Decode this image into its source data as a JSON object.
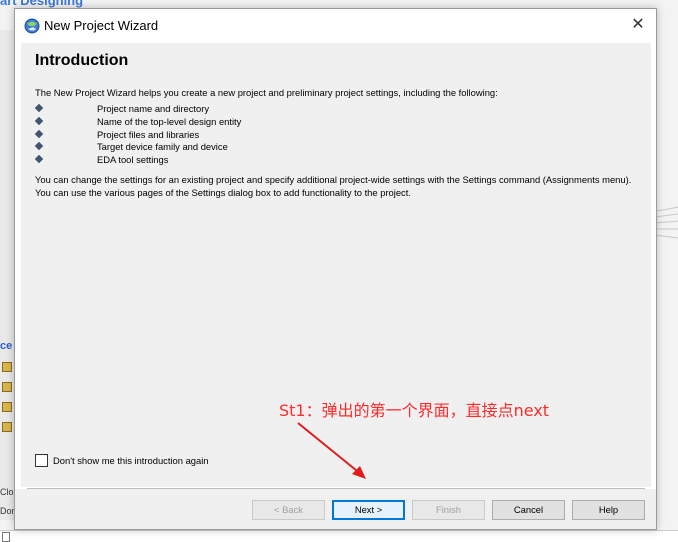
{
  "background": {
    "title_fragment": "art Designing",
    "left_fragment_1": "ce",
    "left_fragment_2": "Clos",
    "left_fragment_3": "Don"
  },
  "dialog": {
    "title": "New Project Wizard",
    "close_glyph": "✕",
    "heading": "Introduction",
    "intro_text": "The New Project Wizard helps you create a new project and preliminary project settings, including the following:",
    "bullets": [
      "Project name and directory",
      "Name of the top-level design entity",
      "Project files and libraries",
      "Target device family and device",
      "EDA tool settings"
    ],
    "paragraph": "You can change the settings for an existing project and specify additional project-wide settings with the Settings command (Assignments menu). You can use the various pages of the Settings dialog box to add functionality to the project.",
    "checkbox_label": "Don't show me this introduction again",
    "checkbox_checked": false,
    "buttons": {
      "back": "< Back",
      "next": "Next >",
      "finish": "Finish",
      "cancel": "Cancel",
      "help": "Help"
    }
  },
  "annotation": {
    "text": "St1：弹出的第一个界面，直接点next",
    "color": "#ff2b2b"
  }
}
